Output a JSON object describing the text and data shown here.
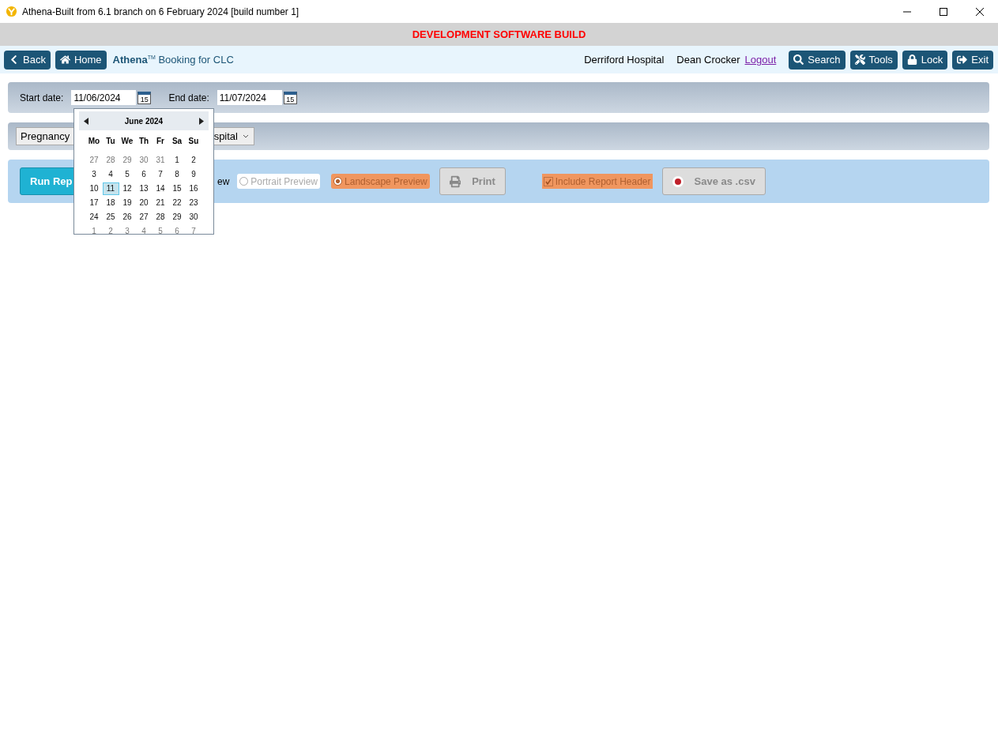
{
  "window": {
    "title": "Athena-Built from 6.1 branch on 6 February 2024 [build number 1]"
  },
  "banner": "DEVELOPMENT SOFTWARE BUILD",
  "nav": {
    "left_buttons": [
      {
        "kind": "back",
        "label": "Back"
      },
      {
        "kind": "home",
        "label": "Home"
      }
    ],
    "app_name": "Athena",
    "trademark": "TM",
    "page_title": "Booking for CLC",
    "location": "Derriford Hospital",
    "user": "Dean Crocker",
    "logout": "Logout",
    "right_buttons": [
      {
        "kind": "search",
        "label": "Search"
      },
      {
        "kind": "tools",
        "label": "Tools"
      },
      {
        "kind": "lock",
        "label": "Lock"
      },
      {
        "kind": "exit",
        "label": "Exit"
      }
    ]
  },
  "dates": {
    "start_label": "Start date:",
    "start_value": "11/06/2024",
    "calendar_icon_text": "15",
    "end_label": "End date:",
    "end_value": "11/07/2024",
    "end_calendar_icon_text": "15"
  },
  "filter": {
    "dropdown_visible_start": "Pregnancy",
    "dropdown_visible_end": "spital"
  },
  "report": {
    "run_button": "Run Rep",
    "preview_label_visible": "ew",
    "options": [
      {
        "label": "Portrait Preview",
        "selected": false
      },
      {
        "label": "Landscape Preview",
        "selected": true
      }
    ],
    "print": {
      "label": "Print",
      "disabled": true
    },
    "include_header": {
      "label": "Include Report Header",
      "checked": true
    },
    "save_csv": {
      "label": "Save as .csv",
      "disabled": true
    }
  },
  "calendar": {
    "month": "June 2024",
    "weekdays": [
      "Mo",
      "Tu",
      "We",
      "Th",
      "Fr",
      "Sa",
      "Su"
    ],
    "weeks": [
      [
        {
          "day": "27",
          "other_month": true,
          "selected": false
        },
        {
          "day": "28",
          "other_month": true,
          "selected": false
        },
        {
          "day": "29",
          "other_month": true,
          "selected": false
        },
        {
          "day": "30",
          "other_month": true,
          "selected": false
        },
        {
          "day": "31",
          "other_month": true,
          "selected": false
        },
        {
          "day": "1",
          "other_month": false,
          "selected": false
        },
        {
          "day": "2",
          "other_month": false,
          "selected": false
        }
      ],
      [
        {
          "day": "3",
          "other_month": false,
          "selected": false
        },
        {
          "day": "4",
          "other_month": false,
          "selected": false
        },
        {
          "day": "5",
          "other_month": false,
          "selected": false
        },
        {
          "day": "6",
          "other_month": false,
          "selected": false
        },
        {
          "day": "7",
          "other_month": false,
          "selected": false
        },
        {
          "day": "8",
          "other_month": false,
          "selected": false
        },
        {
          "day": "9",
          "other_month": false,
          "selected": false
        }
      ],
      [
        {
          "day": "10",
          "other_month": false,
          "selected": false
        },
        {
          "day": "11",
          "other_month": false,
          "selected": true
        },
        {
          "day": "12",
          "other_month": false,
          "selected": false
        },
        {
          "day": "13",
          "other_month": false,
          "selected": false
        },
        {
          "day": "14",
          "other_month": false,
          "selected": false
        },
        {
          "day": "15",
          "other_month": false,
          "selected": false
        },
        {
          "day": "16",
          "other_month": false,
          "selected": false
        }
      ],
      [
        {
          "day": "17",
          "other_month": false,
          "selected": false
        },
        {
          "day": "18",
          "other_month": false,
          "selected": false
        },
        {
          "day": "19",
          "other_month": false,
          "selected": false
        },
        {
          "day": "20",
          "other_month": false,
          "selected": false
        },
        {
          "day": "21",
          "other_month": false,
          "selected": false
        },
        {
          "day": "22",
          "other_month": false,
          "selected": false
        },
        {
          "day": "23",
          "other_month": false,
          "selected": false
        }
      ],
      [
        {
          "day": "24",
          "other_month": false,
          "selected": false
        },
        {
          "day": "25",
          "other_month": false,
          "selected": false
        },
        {
          "day": "26",
          "other_month": false,
          "selected": false
        },
        {
          "day": "27",
          "other_month": false,
          "selected": false
        },
        {
          "day": "28",
          "other_month": false,
          "selected": false
        },
        {
          "day": "29",
          "other_month": false,
          "selected": false
        },
        {
          "day": "30",
          "other_month": false,
          "selected": false
        }
      ],
      [
        {
          "day": "1",
          "other_month": true,
          "selected": false
        },
        {
          "day": "2",
          "other_month": true,
          "selected": false
        },
        {
          "day": "3",
          "other_month": true,
          "selected": false
        },
        {
          "day": "4",
          "other_month": true,
          "selected": false
        },
        {
          "day": "5",
          "other_month": true,
          "selected": false
        },
        {
          "day": "6",
          "other_month": true,
          "selected": false
        },
        {
          "day": "7",
          "other_month": true,
          "selected": false
        }
      ]
    ]
  }
}
